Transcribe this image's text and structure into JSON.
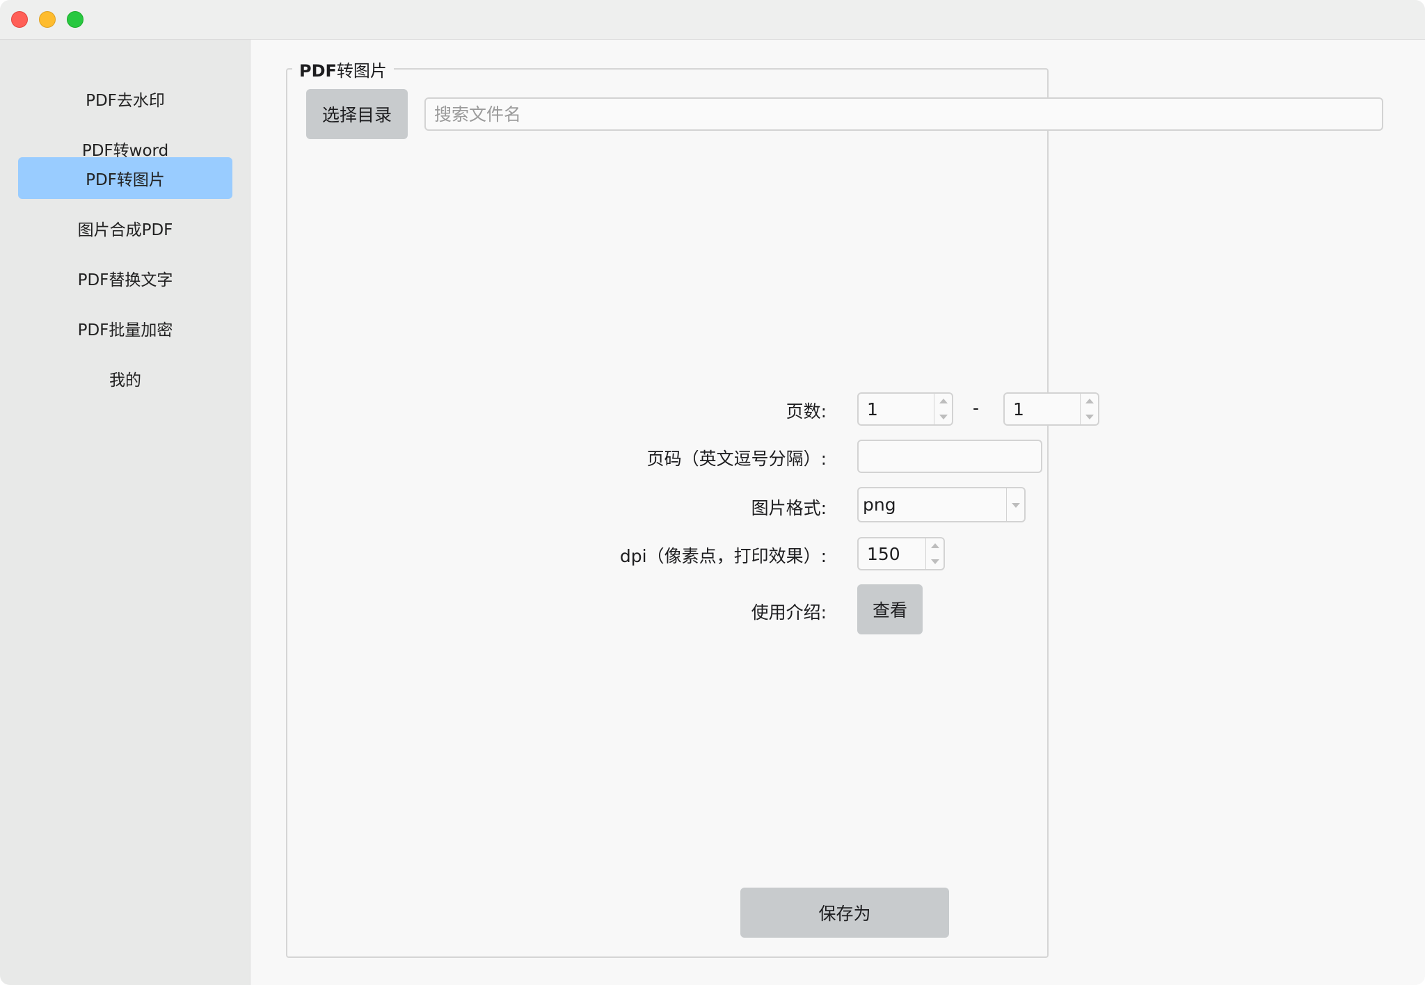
{
  "sidebar": {
    "items": [
      {
        "label": "PDF去水印"
      },
      {
        "label": "PDF转word"
      },
      {
        "label": "PDF转图片",
        "active": true
      },
      {
        "label": "图片合成PDF"
      },
      {
        "label": "PDF替换文字"
      },
      {
        "label": "PDF批量加密"
      },
      {
        "label": "我的"
      }
    ]
  },
  "main": {
    "group_title_prefix": "PDF",
    "group_title_suffix": "转图片",
    "choose_dir_label": "选择目录",
    "search_placeholder": "搜索文件名",
    "search_value": "",
    "form": {
      "pages_label": "页数:",
      "page_from": "1",
      "page_sep": "-",
      "page_to": "1",
      "page_numbers_label": "页码（英文逗号分隔）:",
      "page_numbers_value": "",
      "format_label": "图片格式:",
      "format_value": "png",
      "dpi_label": "dpi（像素点，打印效果）:",
      "dpi_value": "150",
      "intro_label": "使用介绍:",
      "view_label": "查看"
    },
    "save_label": "保存为"
  },
  "colors": {
    "active_nav": "#99ccff",
    "button": "#c8cbcd",
    "traffic_close": "#ff5f57",
    "traffic_min": "#febc2e",
    "traffic_max": "#28c840"
  }
}
